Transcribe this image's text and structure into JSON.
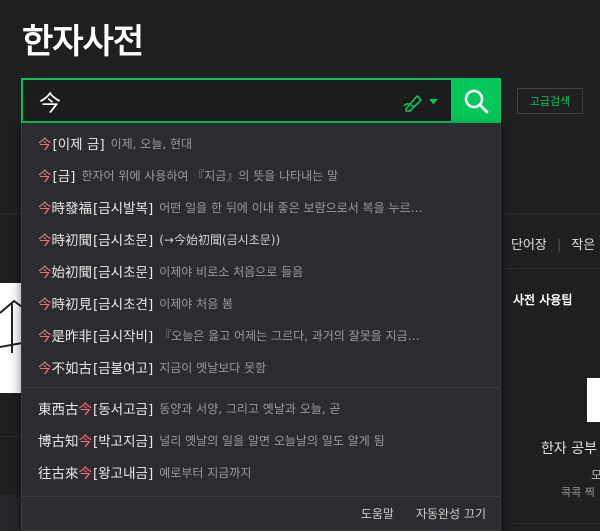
{
  "page_title": "한자사전",
  "search": {
    "value": "今"
  },
  "advanced_search_label": "고급검색",
  "background": {
    "tabs": [
      "단어장",
      "작은"
    ],
    "tips_title": "사전 사용팁",
    "tips_line1": "한자 공부",
    "tips_line2": "모",
    "tips_line3": "콕콕 찍"
  },
  "suggestions_group1": [
    {
      "pre": "",
      "hl": "今",
      "post": "",
      "reading": "[이제 금]",
      "meaning": "이제, 오늘, 현대"
    },
    {
      "pre": "",
      "hl": "今",
      "post": "",
      "reading": "[금]",
      "meaning": "한자어 위에 사용하여 『지금』의 뜻을 나타내는 말"
    },
    {
      "pre": "",
      "hl": "今",
      "post": "時發福",
      "reading": "[금시발복]",
      "meaning": "어떤 일을 한 뒤에 이내 좋은 보람으로서 복을 누르…"
    },
    {
      "pre": "",
      "hl": "今",
      "post": "時初聞",
      "reading": "[금시초문]",
      "meaning": "(→今始初聞(금시초문))"
    },
    {
      "pre": "",
      "hl": "今",
      "post": "始初聞",
      "reading": "[금시초문]",
      "meaning": "이제야 비로소 처음으로 들음"
    },
    {
      "pre": "",
      "hl": "今",
      "post": "時初見",
      "reading": "[금시초견]",
      "meaning": "이제야 처음 봄"
    },
    {
      "pre": "",
      "hl": "今",
      "post": "是昨非",
      "reading": "[금시작비]",
      "meaning": "『오늘은 옳고 어제는 그르다, 과거의 잘못을 지금…"
    },
    {
      "pre": "",
      "hl": "今",
      "post": "不如古",
      "reading": "[금불여고]",
      "meaning": "지금이 옛날보다 못함"
    }
  ],
  "suggestions_group2": [
    {
      "pre": "東西古",
      "hl": "今",
      "post": "",
      "reading": "[동서고금]",
      "meaning": "동양과 서양, 그리고 옛날과 오늘, 곧"
    },
    {
      "pre": "博古知",
      "hl": "今",
      "post": "",
      "reading": "[박고지금]",
      "meaning": "널리 옛날의 일을 알면 오늘날의 일도 알게 됨"
    },
    {
      "pre": "往古來",
      "hl": "今",
      "post": "",
      "reading": "[왕고내금]",
      "meaning": "예로부터 지금까지"
    }
  ],
  "footer": {
    "help": "도움말",
    "autocomplete_off": "자동완성 끄기"
  },
  "colors": {
    "accent": "#03c75a",
    "highlight": "#ff6a7a",
    "background": "#1e1f21"
  },
  "icons": {
    "handwrite": "pen-icon",
    "search": "search-icon",
    "dropdown": "caret-down-icon"
  }
}
